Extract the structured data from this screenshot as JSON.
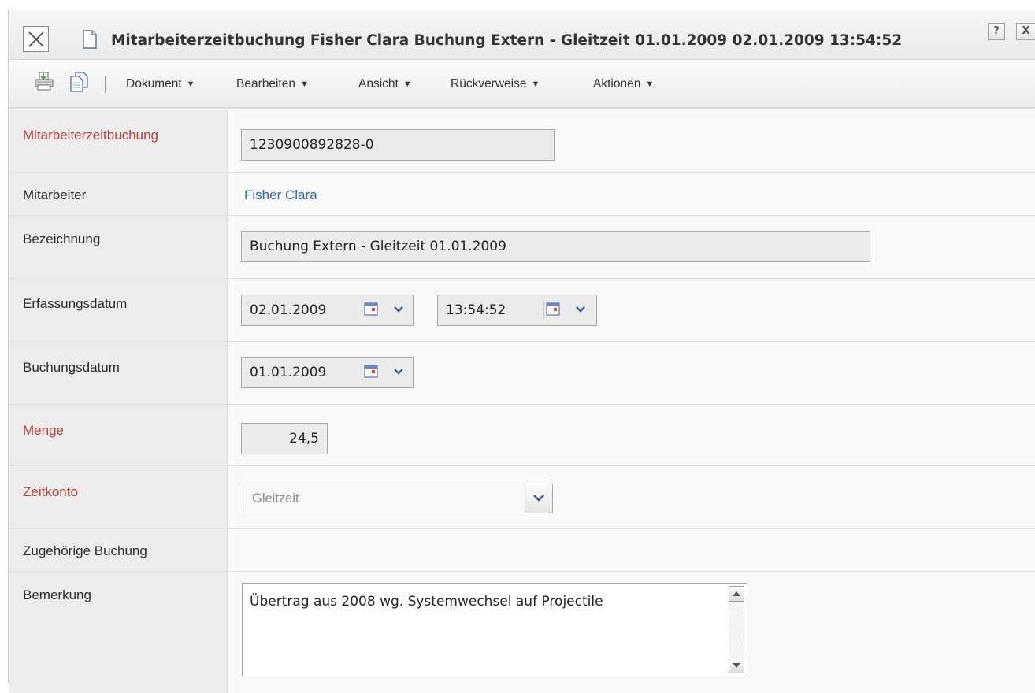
{
  "window": {
    "title": "Mitarbeiterzeitbuchung Fisher Clara Buchung Extern - Gleitzeit 01.01.2009 02.01.2009 13:54:52",
    "help_label": "?",
    "close_label": "X"
  },
  "toolbar": {
    "icons": [
      "print-icon",
      "copy-icon"
    ],
    "menus": [
      {
        "label": "Dokument"
      },
      {
        "label": "Bearbeiten"
      },
      {
        "label": "Ansicht"
      },
      {
        "label": "Rückverweise"
      },
      {
        "label": "Aktionen"
      }
    ]
  },
  "form": {
    "mitarbeiterzeitbuchung": {
      "label": "Mitarbeiterzeitbuchung",
      "value": "1230900892828-0",
      "required": true
    },
    "mitarbeiter": {
      "label": "Mitarbeiter",
      "value": "Fisher Clara"
    },
    "bezeichnung": {
      "label": "Bezeichnung",
      "value": "Buchung Extern - Gleitzeit 01.01.2009"
    },
    "erfassungsdatum": {
      "label": "Erfassungsdatum",
      "date": "02.01.2009",
      "time": "13:54:52"
    },
    "buchungsdatum": {
      "label": "Buchungsdatum",
      "date": "01.01.2009"
    },
    "menge": {
      "label": "Menge",
      "value": "24,5",
      "required": true
    },
    "zeitkonto": {
      "label": "Zeitkonto",
      "value": "Gleitzeit",
      "required": true
    },
    "zugehoerige_buchung": {
      "label": "Zugehörige Buchung"
    },
    "bemerkung": {
      "label": "Bemerkung",
      "value": "Übertrag aus 2008 wg. Systemwechsel auf Projectile"
    }
  },
  "colors": {
    "required_label": "#b5423a",
    "link": "#2f62b3",
    "label_bg": "#ececec"
  }
}
